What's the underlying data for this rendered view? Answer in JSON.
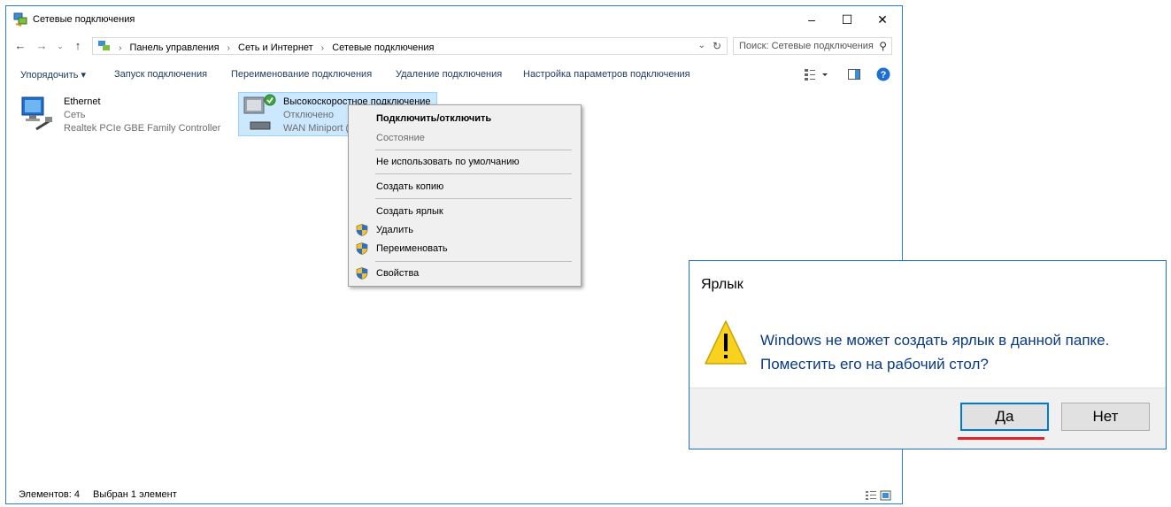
{
  "window": {
    "title": "Сетевые подключения",
    "controls": {
      "minimize": "–",
      "maximize": "☐",
      "close": "✕"
    }
  },
  "address": {
    "breadcrumbs": [
      "Панель управления",
      "Сеть и Интернет",
      "Сетевые подключения"
    ],
    "search_placeholder": "Поиск: Сетевые подключения"
  },
  "toolbar": {
    "organize": "Упорядочить ▾",
    "start": "Запуск подключения",
    "rename": "Переименование подключения",
    "delete": "Удаление подключения",
    "settings": "Настройка параметров подключения"
  },
  "items": [
    {
      "name": "Ethernet",
      "status": "Сеть",
      "device": "Realtek PCIe GBE Family Controller"
    },
    {
      "name": "Высокоскоростное подключение",
      "status": "Отключено",
      "device": "WAN Miniport ("
    }
  ],
  "status_bar": {
    "count": "Элементов: 4",
    "selected": "Выбран 1 элемент"
  },
  "context_menu": {
    "connect": "Подключить/отключить",
    "status": "Состояние",
    "no_default": "Не использовать по умолчанию",
    "copy": "Создать копию",
    "shortcut": "Создать ярлык",
    "delete": "Удалить",
    "rename": "Переименовать",
    "properties": "Свойства"
  },
  "dialog": {
    "title": "Ярлык",
    "message_line1": "Windows не может создать ярлык в данной папке.",
    "message_line2": "Поместить его на рабочий стол?",
    "yes": "Да",
    "no": "Нет"
  },
  "colors": {
    "accent": "#0078d7",
    "selection": "#cce8ff",
    "highlight_underline": "#e0242a"
  }
}
